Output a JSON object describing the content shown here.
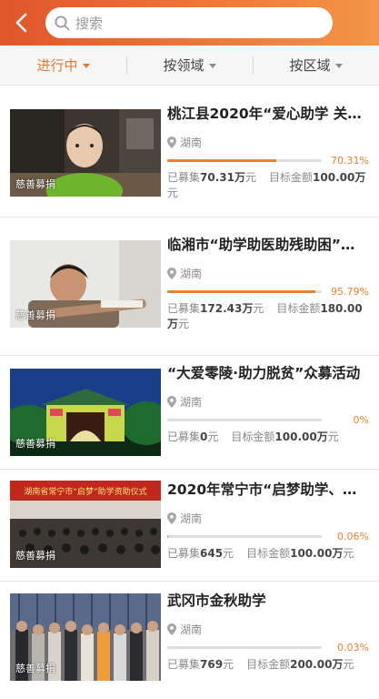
{
  "header": {
    "search_placeholder": "搜索",
    "back_icon": "chevron-left-icon",
    "search_icon": "search-icon",
    "gradient_colors": [
      "#e0562a",
      "#f39546"
    ]
  },
  "filters": [
    {
      "label": "进行中",
      "active": true
    },
    {
      "label": "按领域",
      "active": false
    },
    {
      "label": "按区域",
      "active": false
    }
  ],
  "accent_color": "#ef7e2e",
  "items": [
    {
      "title": "桃江县2020年“爱心助学 关…",
      "tag": "慈善募捐",
      "location": "湖南",
      "percent": "70.31%",
      "progress": 0.7031,
      "raised_label": "已募集",
      "raised_value": "70.31万",
      "raised_unit": "元",
      "target_label": "目标金额",
      "target_value": "100.00万",
      "target_unit": "元"
    },
    {
      "title": "临湘市“助学助医助残助困”…",
      "tag": "慈善募捐",
      "location": "湖南",
      "percent": "95.79%",
      "progress": 0.9579,
      "raised_label": "已募集",
      "raised_value": "172.43万",
      "raised_unit": "元",
      "target_label": "目标金额",
      "target_value": "180.00万",
      "target_unit": "元"
    },
    {
      "title": "“大爱零陵·助力脱贫”众募活动",
      "tag": "慈善募捐",
      "location": "湖南",
      "percent": "0%",
      "progress": 0.0,
      "raised_label": "已募集",
      "raised_value": "0",
      "raised_unit": "元",
      "target_label": "目标金额",
      "target_value": "100.00万",
      "target_unit": "元"
    },
    {
      "title": "2020年常宁市“启梦助学、…",
      "tag": "慈善募捐",
      "location": "湖南",
      "percent": "0.06%",
      "progress": 0.0006,
      "raised_label": "已募集",
      "raised_value": "645",
      "raised_unit": "元",
      "target_label": "目标金额",
      "target_value": "100.00万",
      "target_unit": "元",
      "banner_text": "湖南省常宁市“启梦”助学资助仪式"
    },
    {
      "title": "武冈市金秋助学",
      "tag": "慈善募捐",
      "location": "湖南",
      "percent": "0.03%",
      "progress": 0.0003,
      "raised_label": "已募集",
      "raised_value": "769",
      "raised_unit": "元",
      "target_label": "目标金额",
      "target_value": "200.00万",
      "target_unit": "元"
    }
  ]
}
